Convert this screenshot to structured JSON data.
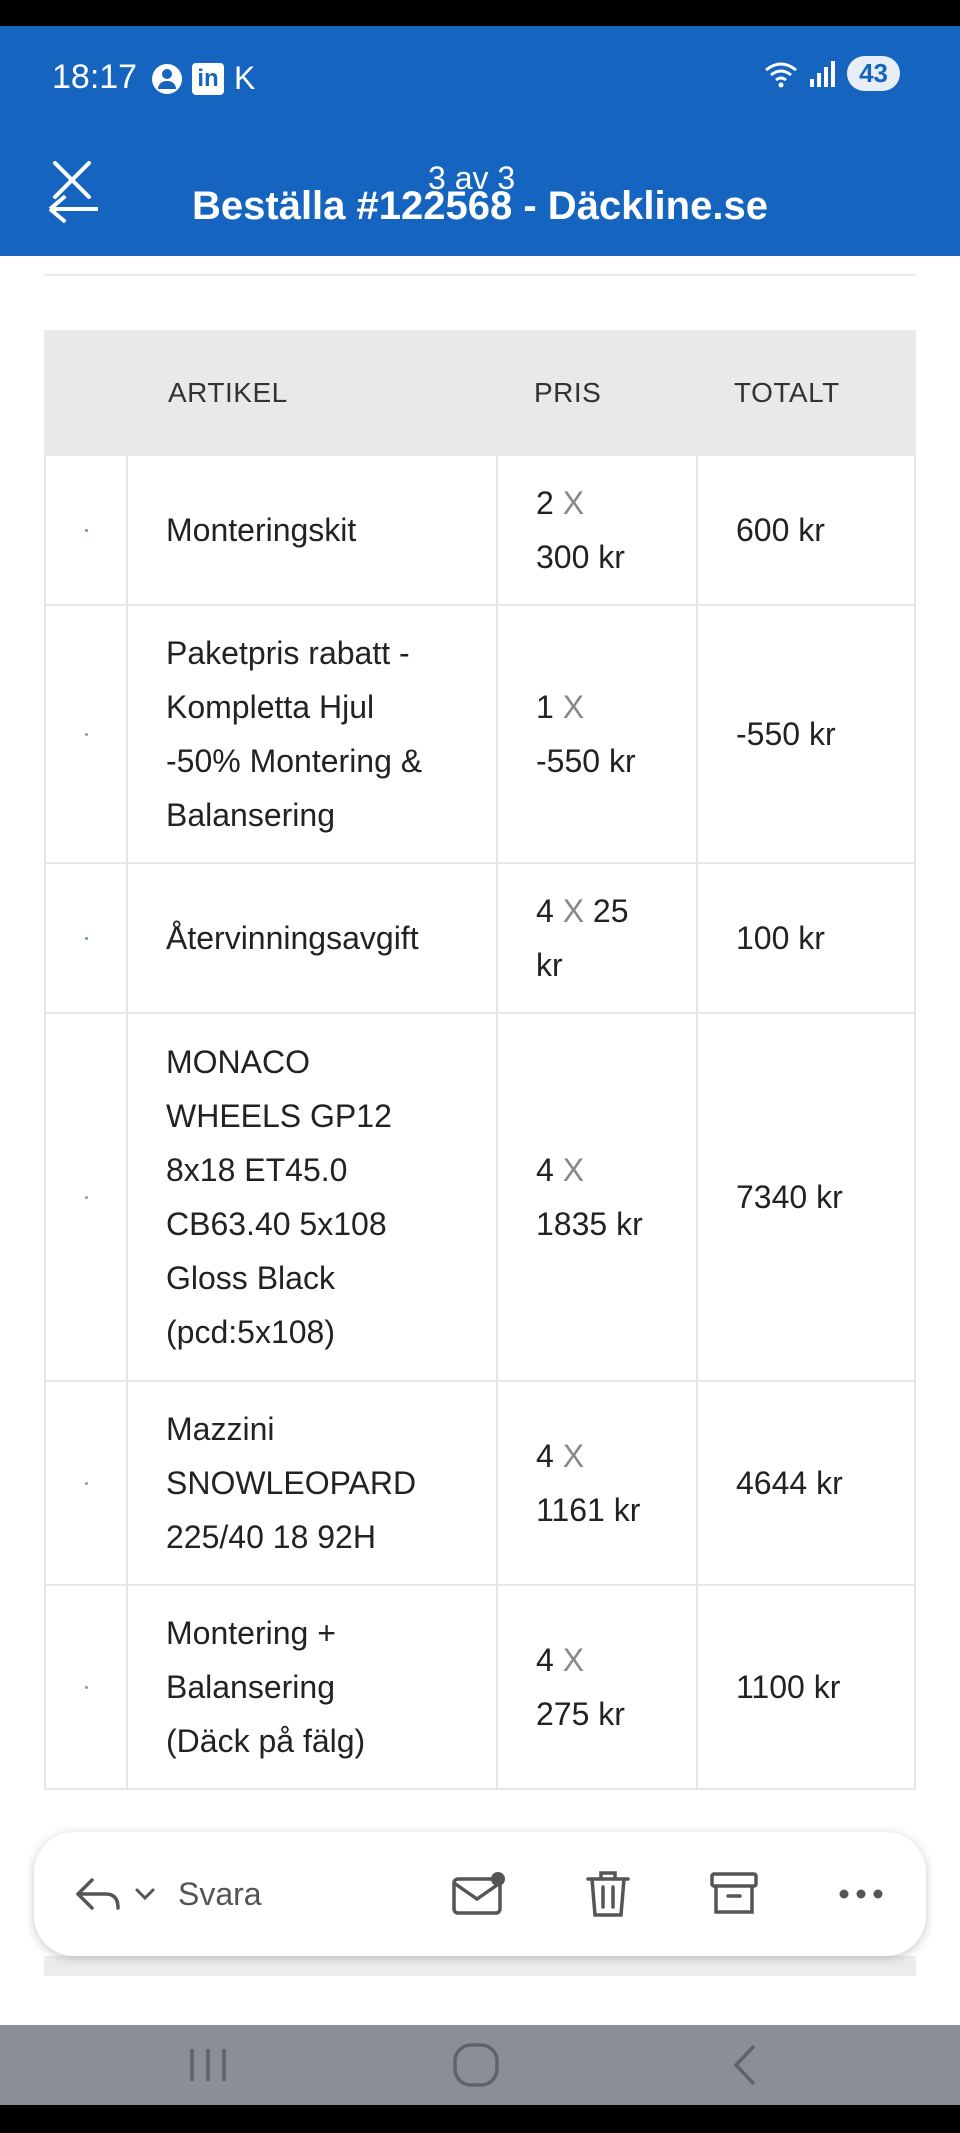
{
  "status": {
    "time": "18:17",
    "carrier": "K",
    "battery": "43",
    "linkedin": "in"
  },
  "header": {
    "pager": "3 av 3",
    "title": "Beställa #122568 - Däckline.se"
  },
  "table": {
    "headers": [
      "ARTIKEL",
      "PRIS",
      "TOTALT"
    ],
    "rows": [
      {
        "article": [
          "Monteringskit"
        ],
        "qty": "2",
        "price_first": "300 kr",
        "price_rest": "",
        "total": "600 kr"
      },
      {
        "article": [
          "Paketpris rabatt -",
          "Kompletta Hjul",
          "-50% Montering &",
          "Balansering"
        ],
        "qty": "1",
        "price_first": "-550 kr",
        "price_rest": "",
        "total": "-550 kr"
      },
      {
        "article": [
          "Återvinningsavgift"
        ],
        "qty": "4",
        "price_first": "25",
        "price_rest": "kr",
        "total": "100 kr"
      },
      {
        "article": [
          "MONACO",
          "WHEELS GP12",
          "8x18 ET45.0",
          "CB63.40 5x108",
          "Gloss Black",
          "(pcd:5x108)"
        ],
        "qty": "4",
        "price_first": "1835 kr",
        "price_rest": "",
        "total": "7340 kr"
      },
      {
        "article": [
          "Mazzini",
          "SNOWLEOPARD",
          "225/40 18 92H"
        ],
        "qty": "4",
        "price_first": "1161 kr",
        "price_rest": "",
        "total": "4644 kr"
      },
      {
        "article": [
          "Montering +",
          "Balansering",
          "(Däck på fälg)"
        ],
        "qty": "4",
        "price_first": "275 kr",
        "price_rest": "",
        "total": "1100 kr"
      }
    ],
    "x_symbol": "X"
  },
  "actions": {
    "reply_label": "Svara"
  },
  "icons": {
    "close": "close-icon",
    "back": "back-arrow-icon",
    "reply": "reply-icon",
    "chevron": "chevron-down-icon",
    "mark_unread": "mark-unread-icon",
    "delete": "trash-icon",
    "archive": "archive-icon",
    "more": "more-icon",
    "recents": "recents-icon",
    "home": "home-icon",
    "nav_back": "nav-back-icon",
    "wifi": "wifi-icon",
    "signal": "signal-icon"
  },
  "colors": {
    "header_bg": "#1565c0",
    "table_header_bg": "#e9e9e9"
  }
}
